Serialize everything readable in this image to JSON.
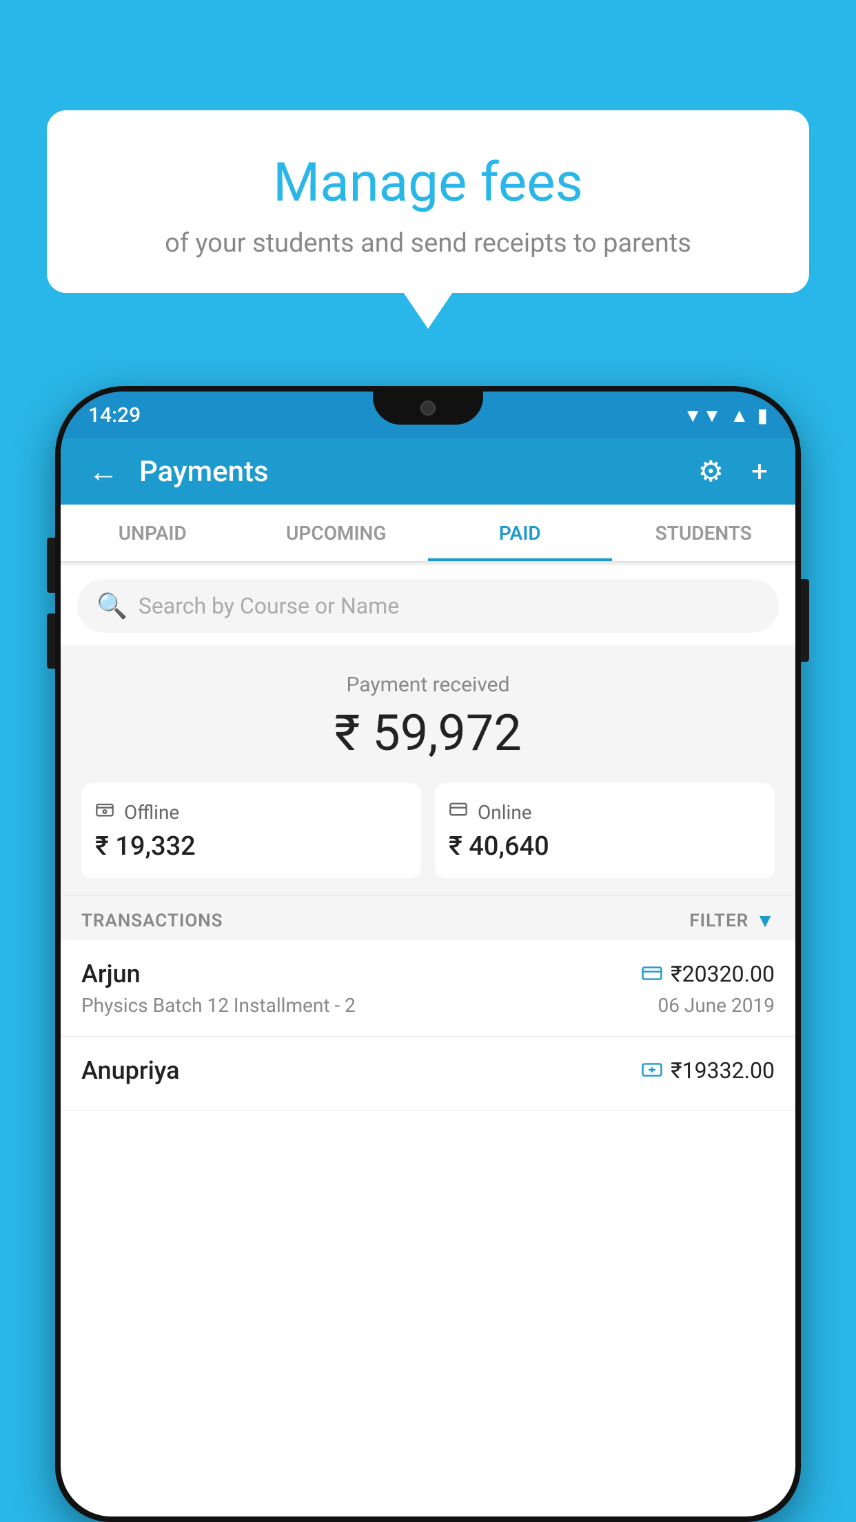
{
  "background": {
    "color": "#29b6e8"
  },
  "bubble": {
    "title": "Manage fees",
    "subtitle": "of your students and send receipts to parents"
  },
  "status_bar": {
    "time": "14:29",
    "wifi": "▲",
    "signal": "▲",
    "battery": "▮"
  },
  "app_bar": {
    "title": "Payments",
    "back_label": "←",
    "gear_label": "⚙",
    "plus_label": "+"
  },
  "tabs": [
    {
      "label": "UNPAID",
      "active": false
    },
    {
      "label": "UPCOMING",
      "active": false
    },
    {
      "label": "PAID",
      "active": true
    },
    {
      "label": "STUDENTS",
      "active": false
    }
  ],
  "search": {
    "placeholder": "Search by Course or Name"
  },
  "payment_summary": {
    "label": "Payment received",
    "amount": "₹ 59,972",
    "offline": {
      "icon": "💳",
      "label": "Offline",
      "amount": "₹ 19,332"
    },
    "online": {
      "icon": "💳",
      "label": "Online",
      "amount": "₹ 40,640"
    }
  },
  "transactions": {
    "section_label": "TRANSACTIONS",
    "filter_label": "FILTER",
    "rows": [
      {
        "name": "Arjun",
        "course": "Physics Batch 12 Installment - 2",
        "amount": "₹20320.00",
        "date": "06 June 2019",
        "icon": "card"
      },
      {
        "name": "Anupriya",
        "course": "",
        "amount": "₹19332.00",
        "date": "",
        "icon": "cash"
      }
    ]
  }
}
